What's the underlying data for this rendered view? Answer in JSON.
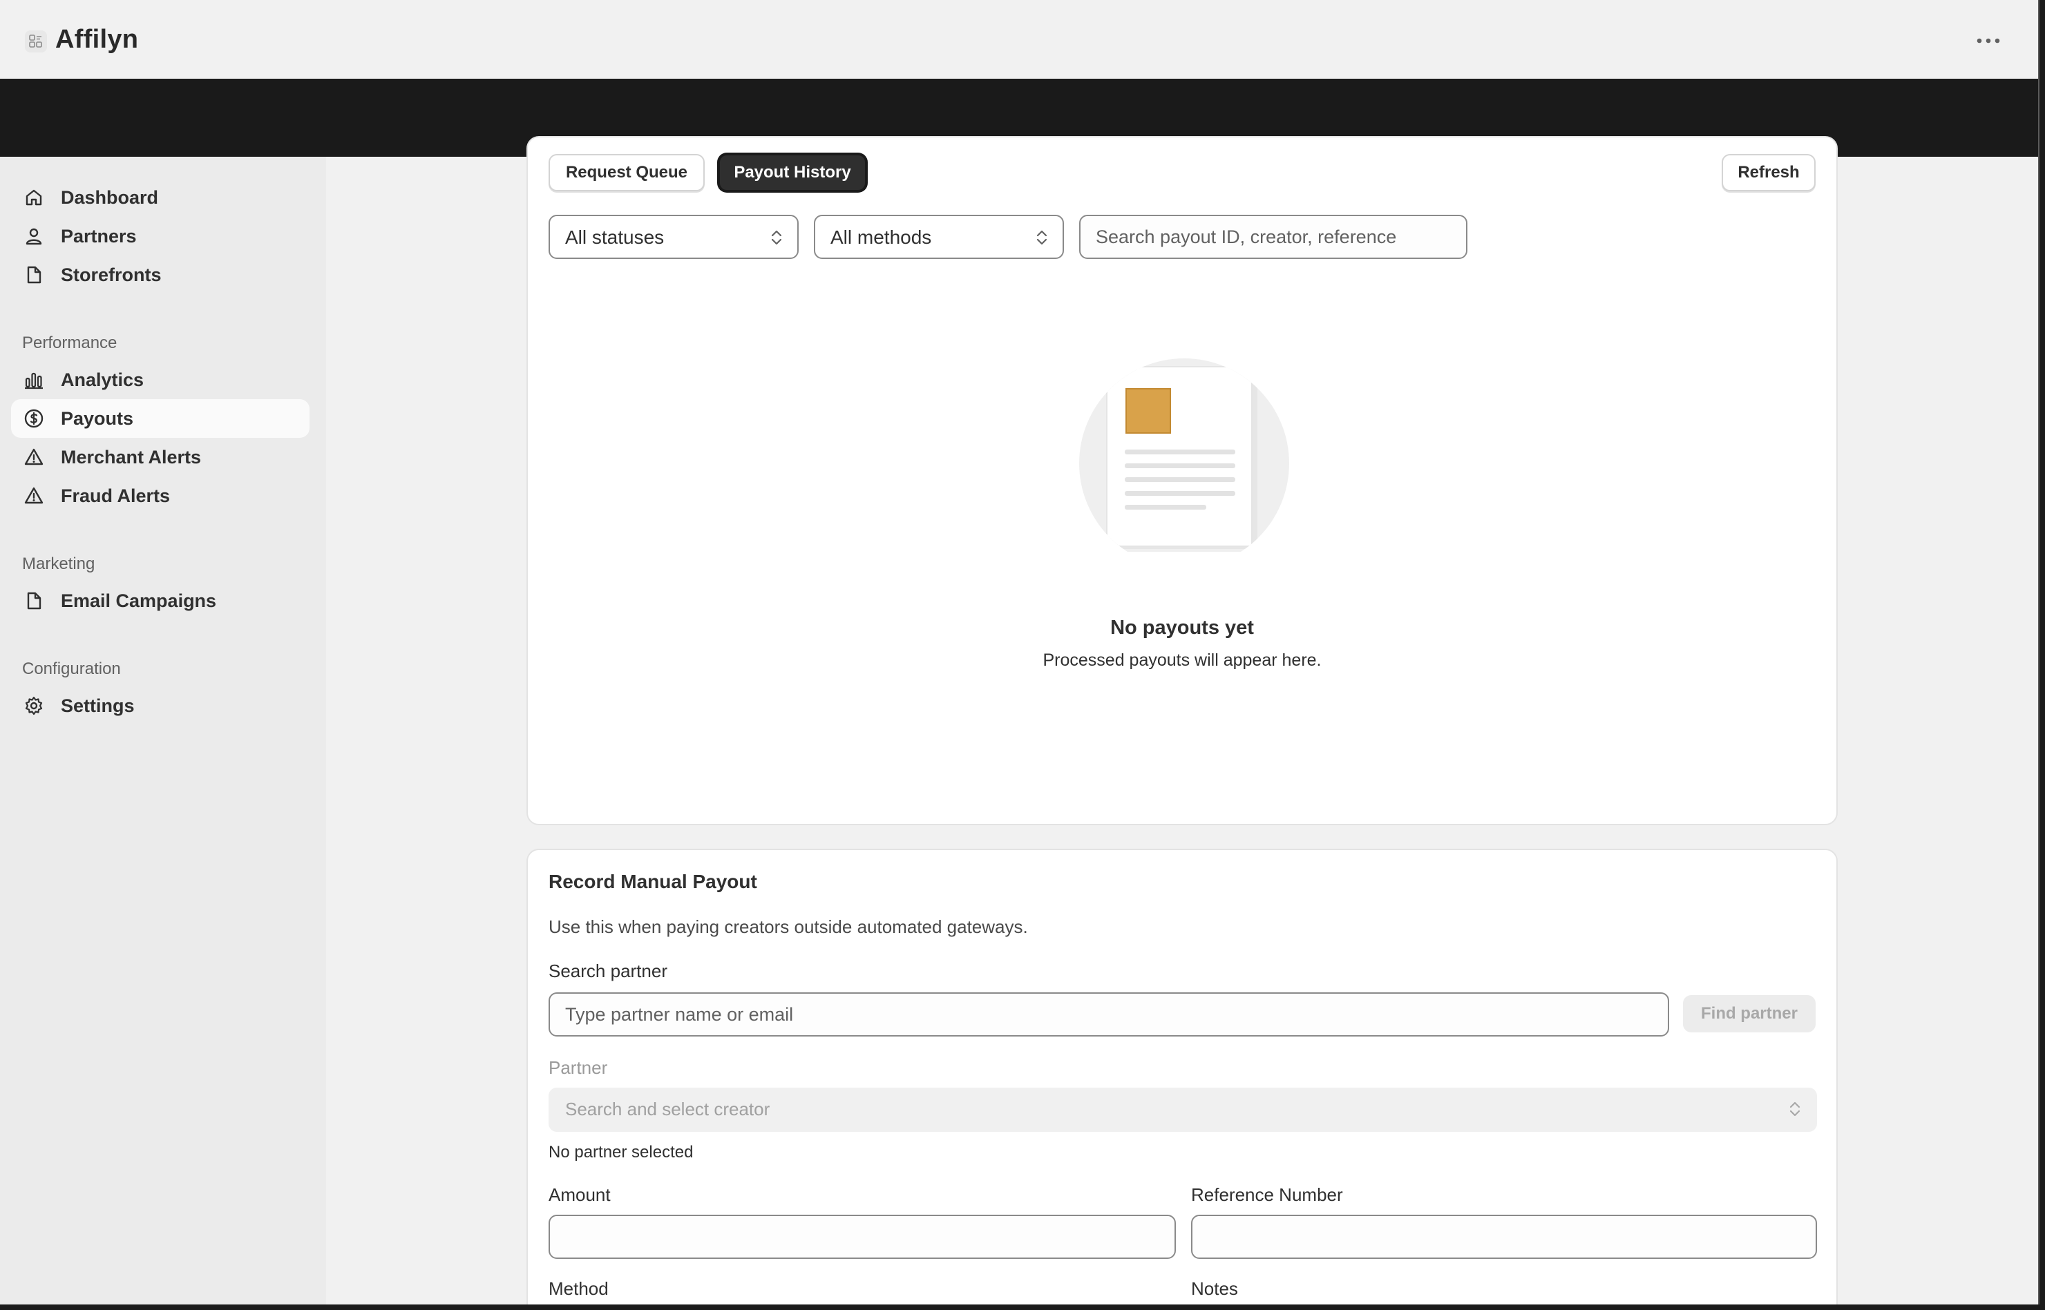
{
  "app": {
    "name": "Affilyn"
  },
  "sidebar": {
    "items": [
      {
        "label": "Dashboard",
        "icon": "home-icon"
      },
      {
        "label": "Partners",
        "icon": "person-icon"
      },
      {
        "label": "Storefronts",
        "icon": "document-icon"
      }
    ],
    "sections": [
      {
        "title": "Performance",
        "items": [
          {
            "label": "Analytics",
            "icon": "bar-chart-icon"
          },
          {
            "label": "Payouts",
            "icon": "dollar-circle-icon",
            "active": true
          },
          {
            "label": "Merchant Alerts",
            "icon": "alert-triangle-icon"
          },
          {
            "label": "Fraud Alerts",
            "icon": "alert-triangle-icon"
          }
        ]
      },
      {
        "title": "Marketing",
        "items": [
          {
            "label": "Email Campaigns",
            "icon": "document-icon"
          }
        ]
      },
      {
        "title": "Configuration",
        "items": [
          {
            "label": "Settings",
            "icon": "gear-icon"
          }
        ]
      }
    ]
  },
  "payouts": {
    "tabs": {
      "request_queue": "Request Queue",
      "payout_history": "Payout History"
    },
    "refresh_label": "Refresh",
    "filters": {
      "status": "All statuses",
      "method": "All methods",
      "search_placeholder": "Search payout ID, creator, reference"
    },
    "empty": {
      "title": "No payouts yet",
      "subtitle": "Processed payouts will appear here."
    }
  },
  "manual": {
    "title": "Record Manual Payout",
    "description": "Use this when paying creators outside automated gateways.",
    "search_label": "Search partner",
    "search_placeholder": "Type partner name or email",
    "find_button": "Find partner",
    "partner_label": "Partner",
    "partner_placeholder": "Search and select creator",
    "partner_helper": "No partner selected",
    "amount_label": "Amount",
    "amount_value": "",
    "reference_label": "Reference Number",
    "reference_value": "",
    "method_label": "Method",
    "notes_label": "Notes"
  },
  "colors": {
    "accent_dark": "#2f2f2f",
    "sidebar_bg": "#ebebeb",
    "topband": "#1a1a1a",
    "illustration_orange": "#d9a24a"
  }
}
